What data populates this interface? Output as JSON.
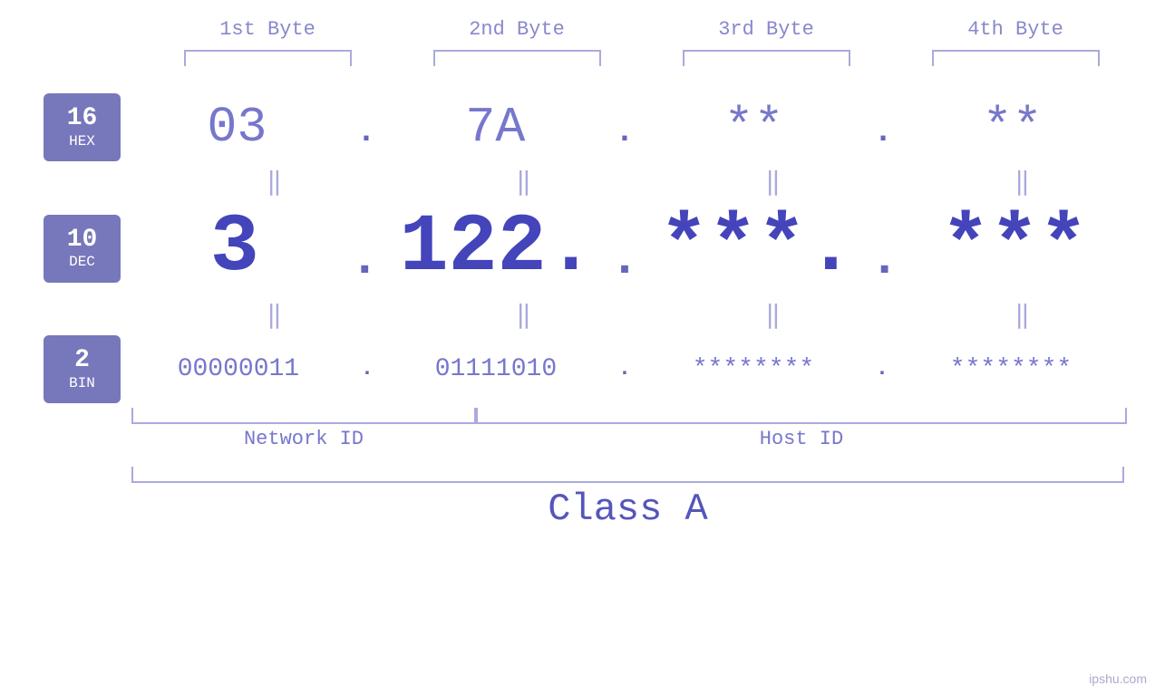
{
  "header": {
    "byte1": "1st Byte",
    "byte2": "2nd Byte",
    "byte3": "3rd Byte",
    "byte4": "4th Byte"
  },
  "badges": {
    "hex": {
      "number": "16",
      "label": "HEX"
    },
    "dec": {
      "number": "10",
      "label": "DEC"
    },
    "bin": {
      "number": "2",
      "label": "BIN"
    }
  },
  "hex_row": {
    "b1": "03",
    "b2": "7A",
    "b3": "**",
    "b4": "**"
  },
  "dec_row": {
    "b1": "3",
    "b2": "122.",
    "b3": "***.",
    "b4": "***"
  },
  "bin_row": {
    "b1": "00000011",
    "b2": "01111010",
    "b3": "********",
    "b4": "********"
  },
  "labels": {
    "network_id": "Network ID",
    "host_id": "Host ID",
    "class": "Class A"
  },
  "watermark": "ipshu.com",
  "colors": {
    "badge_bg": "#7777bb",
    "text_light": "#7777cc",
    "text_dark": "#4444bb",
    "bracket": "#aaaadd"
  }
}
